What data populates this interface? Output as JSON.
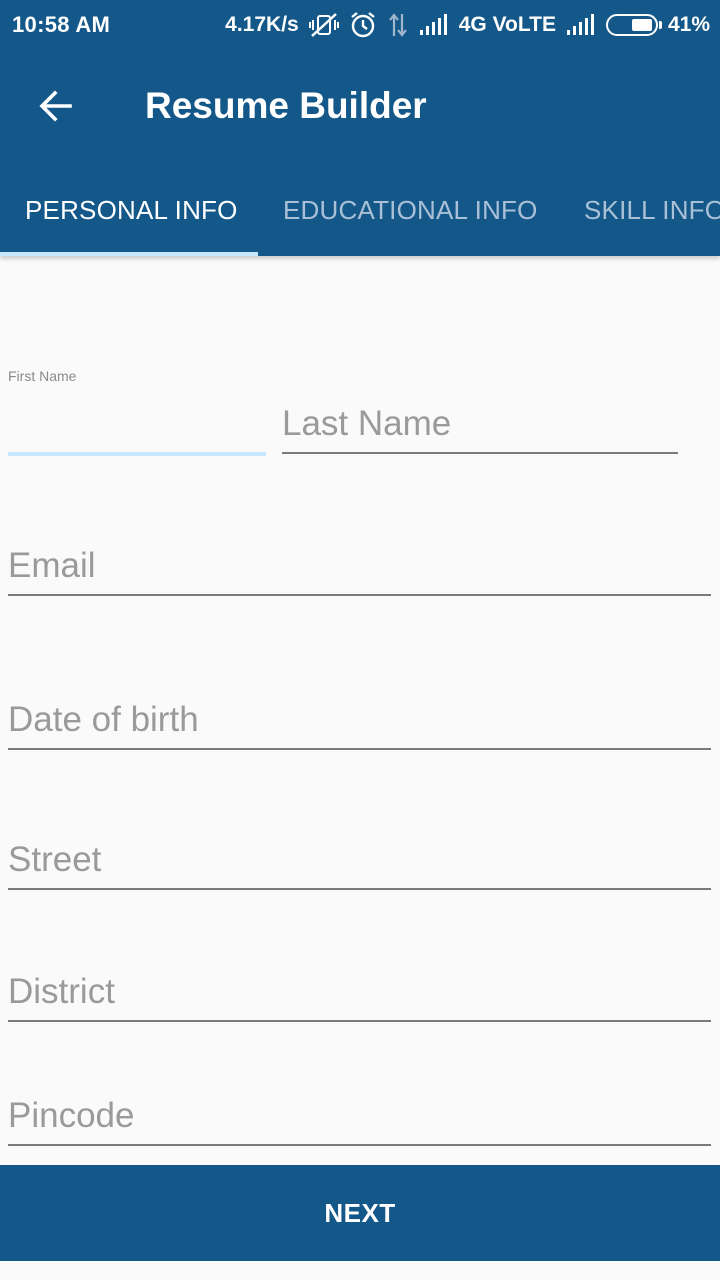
{
  "status_bar": {
    "time": "10:58 AM",
    "speed": "4.17K/s",
    "network": "4G VoLTE",
    "battery": "41%",
    "icons": [
      "vibrate-off-icon",
      "alarm-icon",
      "data-transfer-icon",
      "signal-icon",
      "signal-icon",
      "battery-icon"
    ]
  },
  "app_bar": {
    "title": "Resume Builder",
    "back_icon": "arrow-left-icon"
  },
  "tabs": [
    {
      "label": "PERSONAL INFO",
      "active": true
    },
    {
      "label": "EDUCATIONAL INFO",
      "active": false
    },
    {
      "label": "SKILL INFO",
      "active": false
    }
  ],
  "form": {
    "first_name": {
      "label": "First Name",
      "value": ""
    },
    "last_name": {
      "placeholder": "Last Name",
      "value": ""
    },
    "email": {
      "placeholder": "Email",
      "value": ""
    },
    "dob": {
      "placeholder": "Date of birth",
      "value": ""
    },
    "street": {
      "placeholder": "Street",
      "value": ""
    },
    "district": {
      "placeholder": "District",
      "value": ""
    },
    "pincode": {
      "placeholder": "Pincode",
      "value": ""
    }
  },
  "next_label": "NEXT",
  "colors": {
    "primary": "#14588a",
    "tab_indicator": "#c7e6ff",
    "background": "#fafafa"
  }
}
